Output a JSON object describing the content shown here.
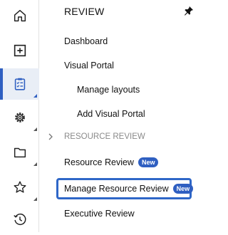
{
  "panel": {
    "title": "REVIEW",
    "items": [
      {
        "label": "Dashboard"
      },
      {
        "label": "Visual Portal"
      },
      {
        "label": "Manage layouts"
      },
      {
        "label": "Add Visual Portal"
      }
    ],
    "section_label": "RESOURCE REVIEW",
    "section_items": [
      {
        "label": "Resource Review",
        "badge": "New"
      },
      {
        "label": "Manage Resource Review",
        "badge": "New",
        "highlighted": true
      },
      {
        "label": "Executive Review"
      }
    ]
  },
  "rail": {
    "icons": [
      "home-icon",
      "add-box-icon",
      "clipboard-checklist-icon",
      "gear-icon",
      "folder-icon",
      "star-icon",
      "history-icon"
    ],
    "active": "clipboard-checklist-icon"
  },
  "colors": {
    "accent": "#2f5fc1",
    "highlight_border": "#2f67c8",
    "muted": "#8a8a8a"
  }
}
